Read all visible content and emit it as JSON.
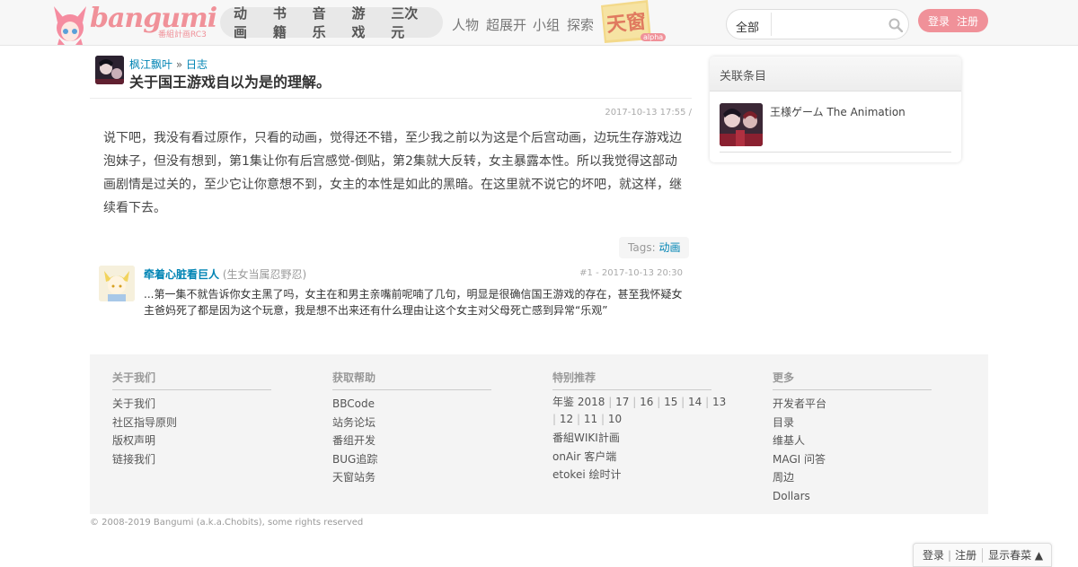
{
  "header": {
    "logo_text": "bangumi",
    "logo_sub": "番組計画RC3",
    "nav_main": [
      "动画",
      "书籍",
      "音乐",
      "游戏",
      "三次元"
    ],
    "nav_secondary": [
      "人物",
      "超展开",
      "小组",
      "探索"
    ],
    "tianchuang": {
      "label": "天窗",
      "sub": "alpha"
    },
    "search": {
      "category": "全部",
      "value": "",
      "placeholder": ""
    },
    "login": "登录",
    "register": "注册",
    "brand_color": "#f09199"
  },
  "blog": {
    "author": "枫江飘叶",
    "crumb_sep": "»",
    "section": "日志",
    "title": "关于国王游戏自以为是的理解。",
    "date": "2017-10-13 17:55 /",
    "body": "说下吧，我没有看过原作，只看的动画，觉得还不错，至少我之前以为这是个后宫动画，边玩生存游戏边泡妹子，但没有想到，第1集让你有后宫感觉-倒贴，第2集就大反转，女主暴露本性。所以我觉得这部动画剧情是过关的，至少它让你意想不到，女主的本性是如此的黑暗。在这里就不说它的坏吧，就这样，继续看下去。",
    "tags_label": "Tags:",
    "tag": "动画"
  },
  "comment": {
    "name": "牵着心脏看巨人",
    "sign": "(生女当属忍野忍)",
    "meta": "#1 - 2017-10-13 20:30",
    "text": "...第一集不就告诉你女主黑了吗，女主在和男主亲嘴前呢喃了几句，明显是很确信国王游戏的存在，甚至我怀疑女主爸妈死了都是因为这个玩意，我是想不出来还有什么理由让这个女主对父母死亡感到异常“乐观”"
  },
  "sidebar": {
    "heading": "关联条目",
    "item_title": "王様ゲーム The Animation"
  },
  "footer": {
    "col1": {
      "heading": "关于我们",
      "items": [
        "关于我们",
        "社区指导原则",
        "版权声明",
        "链接我们"
      ]
    },
    "col2": {
      "heading": "获取帮助",
      "items": [
        "BBCode",
        "站务论坛",
        "番组开发",
        "BUG追踪",
        "天窗站务"
      ]
    },
    "col3": {
      "heading": "特别推荐",
      "year_prefix": "年鉴",
      "years": [
        "2018",
        "17",
        "16",
        "15",
        "14",
        "13",
        "12",
        "11",
        "10"
      ],
      "items": [
        "番組WIKI計画",
        "onAir 客户端",
        "etokei 绘时计"
      ]
    },
    "col4": {
      "heading": "更多",
      "items": [
        "开发者平台",
        "目录",
        "维基人",
        "MAGI 问答",
        "周边",
        "Dollars"
      ]
    },
    "copyright": "© 2008-2019 Bangumi (a.k.a.Chobits), some rights reserved"
  },
  "bottom_bar": {
    "login": "登录",
    "register": "注册",
    "menu": "显示春菜 ▲"
  }
}
